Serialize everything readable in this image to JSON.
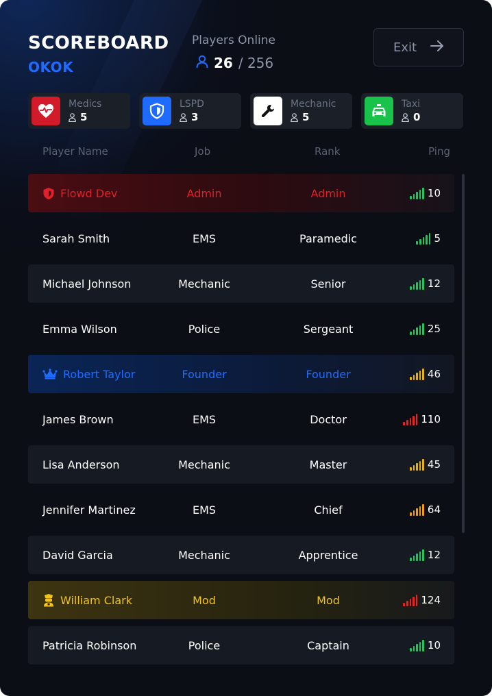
{
  "header": {
    "title": "SCOREBOARD",
    "subtitle": "OKOK",
    "online_label": "Players Online",
    "online_count": "26",
    "online_max": "/ 256",
    "user_icon": "user-outline-icon",
    "exit_label": "Exit",
    "exit_icon": "arrow-right-icon"
  },
  "jobs": [
    {
      "name": "Medics",
      "count": "5",
      "icon": "heart-pulse-icon",
      "color": "#d11a2a"
    },
    {
      "name": "LSPD",
      "count": "3",
      "icon": "shield-icon",
      "color": "#1f6bff"
    },
    {
      "name": "Mechanic",
      "count": "5",
      "icon": "wrench-icon",
      "color": "#ffffff"
    },
    {
      "name": "Taxi",
      "count": "0",
      "icon": "taxi-icon",
      "color": "#19c24a"
    }
  ],
  "columns": {
    "name": "Player Name",
    "job": "Job",
    "rank": "Rank",
    "ping": "Ping"
  },
  "colors": {
    "admin": "#e0202a",
    "founder": "#1f6bff",
    "mod": "#f2c41d",
    "ping_good": "#22c55e",
    "ping_medium": "#eab308",
    "ping_fair": "#f59e0b",
    "ping_bad": "#ef2222"
  },
  "players": [
    {
      "name": "Flowd Dev",
      "job": "Admin",
      "rank": "Admin",
      "ping": "10",
      "role": "admin",
      "role_icon": "shield-icon",
      "ping_level": "good"
    },
    {
      "name": "Sarah Smith",
      "job": "EMS",
      "rank": "Paramedic",
      "ping": "5",
      "role": "",
      "ping_level": "good"
    },
    {
      "name": "Michael Johnson",
      "job": "Mechanic",
      "rank": "Senior",
      "ping": "12",
      "role": "",
      "ping_level": "good"
    },
    {
      "name": "Emma Wilson",
      "job": "Police",
      "rank": "Sergeant",
      "ping": "25",
      "role": "",
      "ping_level": "good"
    },
    {
      "name": "Robert Taylor",
      "job": "Founder",
      "rank": "Founder",
      "ping": "46",
      "role": "founder",
      "role_icon": "crown-icon",
      "ping_level": "medium"
    },
    {
      "name": "James Brown",
      "job": "EMS",
      "rank": "Doctor",
      "ping": "110",
      "role": "",
      "ping_level": "bad"
    },
    {
      "name": "Lisa Anderson",
      "job": "Mechanic",
      "rank": "Master",
      "ping": "45",
      "role": "",
      "ping_level": "medium"
    },
    {
      "name": "Jennifer Martinez",
      "job": "EMS",
      "rank": "Chief",
      "ping": "64",
      "role": "",
      "ping_level": "fair"
    },
    {
      "name": "David Garcia",
      "job": "Mechanic",
      "rank": "Apprentice",
      "ping": "12",
      "role": "",
      "ping_level": "good"
    },
    {
      "name": "William Clark",
      "job": "Mod",
      "rank": "Mod",
      "ping": "124",
      "role": "mod",
      "role_icon": "police-officer-icon",
      "ping_level": "bad"
    },
    {
      "name": "Patricia Robinson",
      "job": "Police",
      "rank": "Captain",
      "ping": "10",
      "role": "",
      "ping_level": "good"
    }
  ]
}
